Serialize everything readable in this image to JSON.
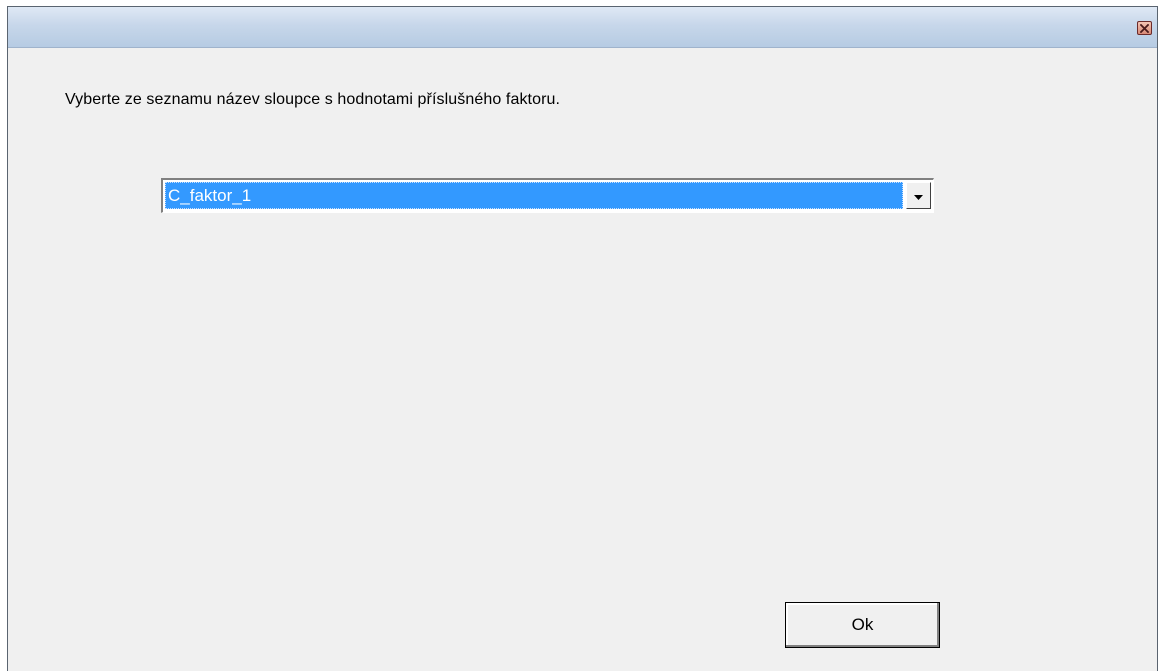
{
  "window": {
    "title": ""
  },
  "titlebar": {
    "close_icon": "close-icon"
  },
  "dialog": {
    "prompt": "Vyberte ze seznamu název sloupce s hodnotami příslušného faktoru.",
    "column_select": {
      "selected_value": "C_faktor_1",
      "arrow_icon": "dropdown-arrow-icon"
    },
    "ok_label": "Ok"
  },
  "colors": {
    "selection": "#3399ff",
    "dialog_bg": "#f0f0f0",
    "close_button": "#d98a76"
  }
}
